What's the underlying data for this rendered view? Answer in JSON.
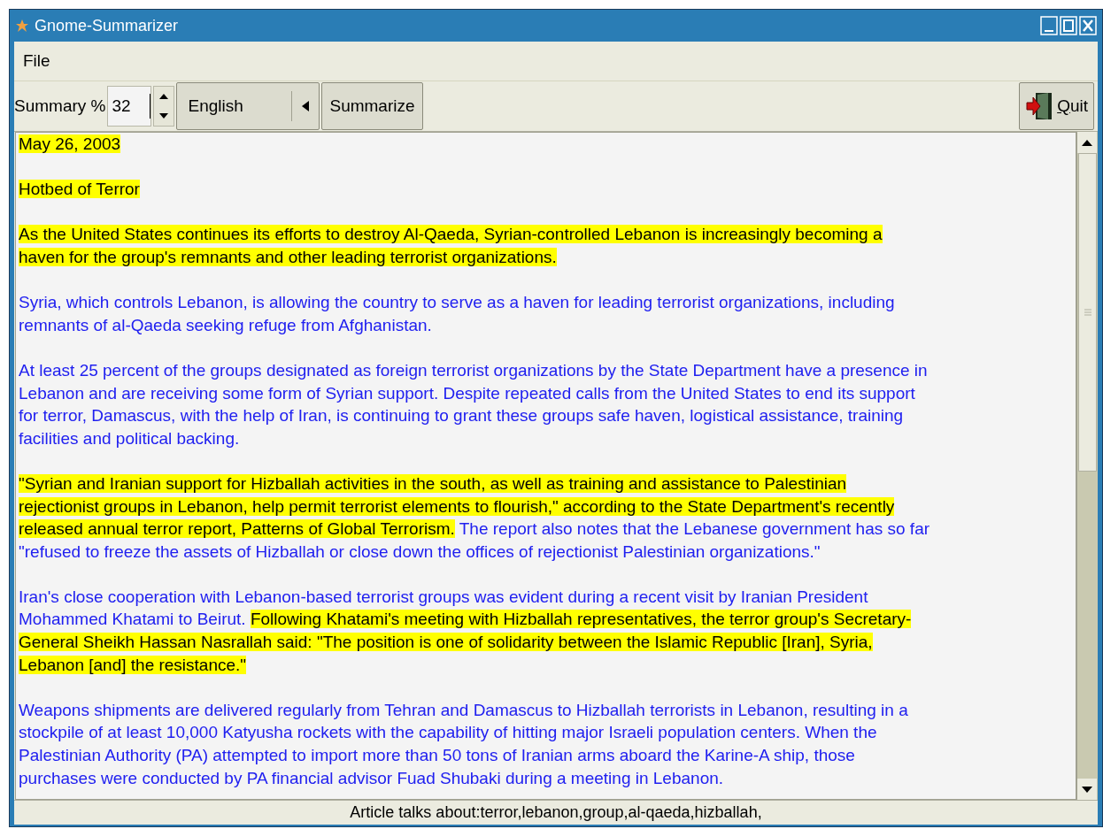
{
  "window": {
    "title": "Gnome-Summarizer"
  },
  "menu": [
    "File"
  ],
  "toolbar": {
    "percent_label": "Summary %",
    "percent_value": "32",
    "language": "English",
    "summarize": "Summarize",
    "quit": "Quit"
  },
  "document": {
    "paragraphs": [
      {
        "lines": [
          [
            {
              "text": "May 26, 2003",
              "highlighted": true
            }
          ]
        ]
      },
      {
        "lines": [
          [
            {
              "text": "Hotbed of Terror",
              "highlighted": true
            }
          ]
        ]
      },
      {
        "lines": [
          [
            {
              "text": "As the United States continues its efforts to destroy Al-Qaeda, Syrian-controlled Lebanon is increasingly becoming a",
              "highlighted": true
            }
          ],
          [
            {
              "text": "haven for the group's remnants and other leading terrorist organizations.",
              "highlighted": true
            }
          ]
        ]
      },
      {
        "lines": [
          [
            {
              "text": "Syria, which controls Lebanon, is allowing the country to serve as a haven for leading terrorist organizations, including",
              "highlighted": false
            }
          ],
          [
            {
              "text": "remnants of al-Qaeda seeking refuge from Afghanistan.",
              "highlighted": false
            }
          ]
        ]
      },
      {
        "lines": [
          [
            {
              "text": "At least 25 percent of the groups designated as foreign terrorist organizations by the State Department have a presence in",
              "highlighted": false
            }
          ],
          [
            {
              "text": "Lebanon and are receiving some form of Syrian support. Despite repeated calls from the United States to end its support",
              "highlighted": false
            }
          ],
          [
            {
              "text": "for terror, Damascus, with the help of Iran, is continuing to grant these groups safe haven, logistical assistance, training",
              "highlighted": false
            }
          ],
          [
            {
              "text": "facilities and political backing.",
              "highlighted": false
            }
          ]
        ]
      },
      {
        "lines": [
          [
            {
              "text": "\"Syrian and Iranian support for Hizballah activities in the south, as well as training and assistance to Palestinian",
              "highlighted": true
            }
          ],
          [
            {
              "text": "rejectionist groups in Lebanon, help permit terrorist elements to flourish,\" according to the State Department's recently",
              "highlighted": true
            }
          ],
          [
            {
              "text": "released annual terror report, Patterns of Global Terrorism.",
              "highlighted": true
            },
            {
              "text": " The report also notes that the Lebanese government has so far",
              "highlighted": false
            }
          ],
          [
            {
              "text": "\"refused to freeze the assets of Hizballah or close down the offices of rejectionist Palestinian organizations.\"",
              "highlighted": false
            }
          ]
        ]
      },
      {
        "lines": [
          [
            {
              "text": "Iran's close cooperation with Lebanon-based terrorist groups was evident during a recent visit by Iranian President",
              "highlighted": false
            }
          ],
          [
            {
              "text": "Mohammed Khatami to Beirut. ",
              "highlighted": false
            },
            {
              "text": "Following Khatami's meeting with Hizballah representatives, the terror group's Secretary-",
              "highlighted": true
            }
          ],
          [
            {
              "text": "General Sheikh Hassan Nasrallah said: \"The position is one of solidarity between the Islamic Republic [Iran], Syria,",
              "highlighted": true
            }
          ],
          [
            {
              "text": "Lebanon [and] the resistance.\"",
              "highlighted": true
            }
          ]
        ]
      },
      {
        "lines": [
          [
            {
              "text": "Weapons shipments are delivered regularly from Tehran and Damascus to Hizballah terrorists in Lebanon, resulting in a",
              "highlighted": false
            }
          ],
          [
            {
              "text": "stockpile of at least 10,000 Katyusha rockets with the capability of hitting major Israeli population centers. When the",
              "highlighted": false
            }
          ],
          [
            {
              "text": "Palestinian Authority (PA) attempted to import more than 50 tons of Iranian arms aboard the Karine-A ship, those",
              "highlighted": false
            }
          ],
          [
            {
              "text": "purchases were conducted by PA financial advisor Fuad Shubaki during a meeting in Lebanon.",
              "highlighted": false
            }
          ]
        ]
      }
    ]
  },
  "status_bar": "Article talks about:terror,lebanon,group,al-qaeda,hizballah,"
}
